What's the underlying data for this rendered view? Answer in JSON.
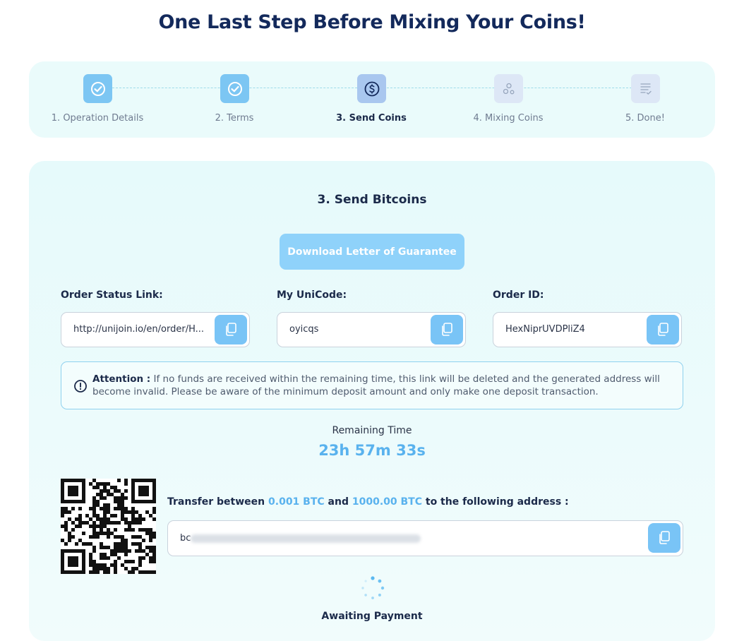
{
  "page": {
    "title": "One Last Step Before Mixing Your Coins!"
  },
  "stepper": {
    "steps": [
      {
        "label": "1. Operation Details",
        "state": "done",
        "icon": "check-circle-icon"
      },
      {
        "label": "2. Terms",
        "state": "done",
        "icon": "check-circle-icon"
      },
      {
        "label": "3. Send Coins",
        "state": "active",
        "icon": "dollar-circle-icon"
      },
      {
        "label": "4. Mixing Coins",
        "state": "pending",
        "icon": "coins-icon"
      },
      {
        "label": "5. Done!",
        "state": "pending",
        "icon": "document-check-icon"
      }
    ]
  },
  "main": {
    "title": "3. Send Bitcoins",
    "download_button": "Download Letter of Guarantee",
    "fields": [
      {
        "label": "Order Status Link:",
        "value": "http://unijoin.io/en/order/H..."
      },
      {
        "label": "My UniCode:",
        "value": "oyicqs"
      },
      {
        "label": "Order ID:",
        "value": "HexNiprUVDPliZ4"
      }
    ],
    "attention": {
      "title": "Attention :",
      "text": "If no funds are received within the remaining time, this link will be deleted and the generated address will become invalid. Please be aware of the minimum deposit amount and only make one deposit transaction."
    },
    "remaining_label": "Remaining Time",
    "remaining_value": "23h 57m 33s",
    "transfer": {
      "prefix": "Transfer between",
      "min": "0.001 BTC",
      "middle": "and",
      "max": "1000.00 BTC",
      "suffix": "to the following address :"
    },
    "address_prefix": "bc",
    "status": "Awaiting Payment"
  },
  "colors": {
    "accent": "#59b2ee",
    "title": "#13295b",
    "copy_button": "#79c4f6",
    "download_button": "#8fd2fa"
  }
}
